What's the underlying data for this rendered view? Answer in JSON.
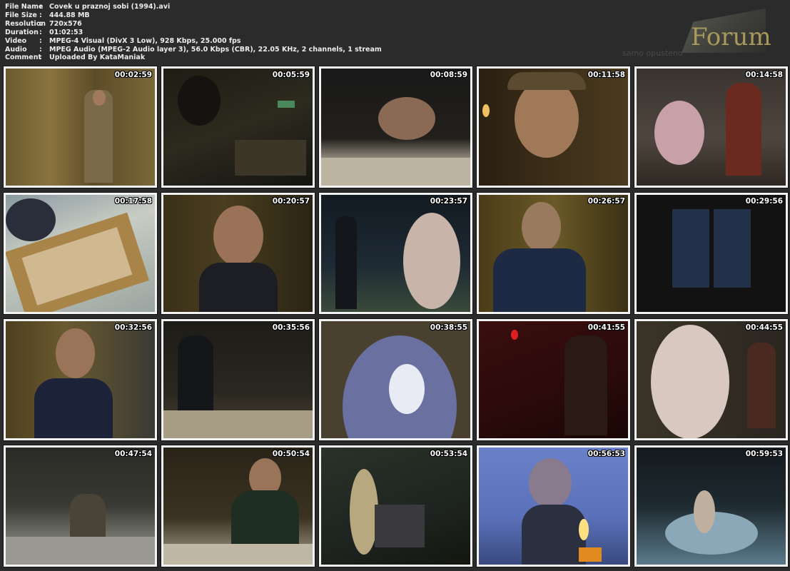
{
  "info": [
    {
      "key": "File Name",
      "value": "Covek u praznoj sobi (1994).avi"
    },
    {
      "key": "File Size",
      "value": "444.88 MB"
    },
    {
      "key": "Resolution",
      "value": "720x576"
    },
    {
      "key": "Duration",
      "value": "01:02:53"
    },
    {
      "key": "Video",
      "value": "MPEG-4 Visual (DivX 3 Low), 928 Kbps, 25.000 fps"
    },
    {
      "key": "Audio",
      "value": "MPEG Audio (MPEG-2 Audio layer 3), 56.0 Kbps (CBR), 22.05 KHz, 2 channels, 1 stream"
    },
    {
      "key": "Comment",
      "value": "Uploaded By KataManiak"
    }
  ],
  "separator": ":",
  "logo": {
    "title": "Forum",
    "subtitle": "samo opusteno"
  },
  "thumbnails": [
    {
      "time": "00:02:59"
    },
    {
      "time": "00:05:59"
    },
    {
      "time": "00:08:59"
    },
    {
      "time": "00:11:58"
    },
    {
      "time": "00:14:58"
    },
    {
      "time": "00:17:58"
    },
    {
      "time": "00:20:57"
    },
    {
      "time": "00:23:57"
    },
    {
      "time": "00:26:57"
    },
    {
      "time": "00:29:56"
    },
    {
      "time": "00:32:56"
    },
    {
      "time": "00:35:56"
    },
    {
      "time": "00:38:55"
    },
    {
      "time": "00:41:55"
    },
    {
      "time": "00:44:55"
    },
    {
      "time": "00:47:54"
    },
    {
      "time": "00:50:54"
    },
    {
      "time": "00:53:54"
    },
    {
      "time": "00:56:53"
    },
    {
      "time": "00:59:53"
    }
  ]
}
